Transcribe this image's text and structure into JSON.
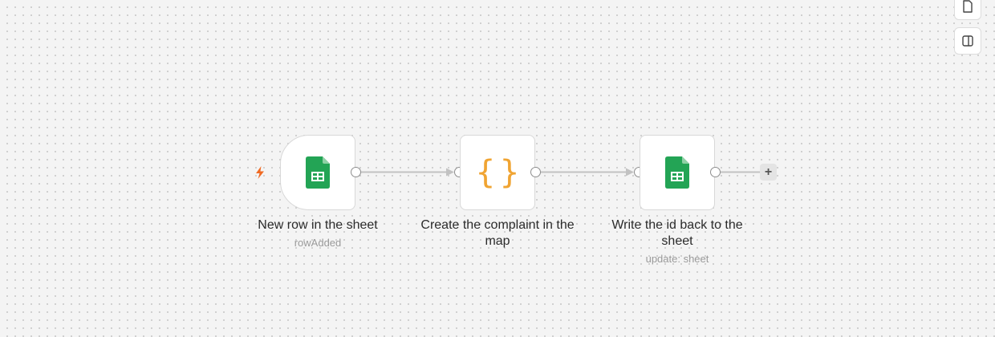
{
  "canvas": {
    "background": "#f4f4f4",
    "dot_color": "#c9c9c9"
  },
  "toolbar": {
    "top_icon": "document-icon",
    "panel_icon": "side-panel-icon"
  },
  "nodes": [
    {
      "title": "New row in the sheet",
      "subtitle": "rowAdded",
      "icon": "google-sheets-icon",
      "is_trigger": true
    },
    {
      "title": "Create the complaint in the map",
      "subtitle": "",
      "icon": "code-braces-icon",
      "glyph": "{}",
      "is_trigger": false
    },
    {
      "title": "Write the id back to the sheet",
      "subtitle": "update: sheet",
      "icon": "google-sheets-icon",
      "is_trigger": false
    }
  ],
  "add_button": {
    "label": "+"
  },
  "colors": {
    "sheets_green": "#23a455",
    "braces_orange": "#f0a432",
    "trigger_orange": "#f06a23",
    "edge_gray": "#c2c2c2"
  }
}
